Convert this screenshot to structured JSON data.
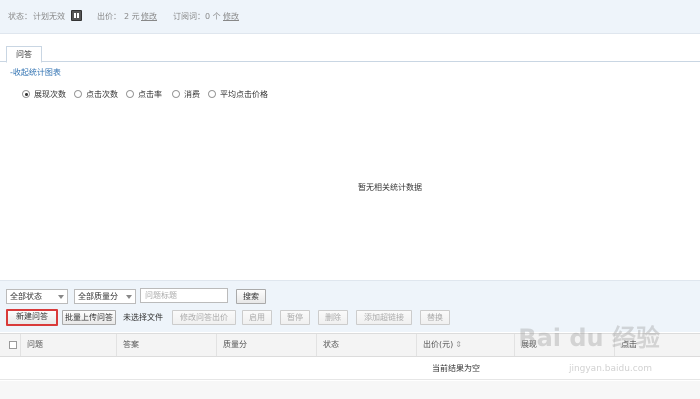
{
  "status_bar": {
    "status_label": "状态：",
    "status_value": "计划无效",
    "bid_label": "出价：",
    "bid_value": "2 元",
    "bid_edit": "修改",
    "subs_label": "订阅词：",
    "subs_value": "0 个",
    "subs_edit": "修改"
  },
  "tabs": [
    {
      "label": "问答"
    }
  ],
  "collapse_link": "-收起统计图表",
  "metrics": [
    {
      "label": "展现次数",
      "selected": true
    },
    {
      "label": "点击次数",
      "selected": false
    },
    {
      "label": "点击率",
      "selected": false
    },
    {
      "label": "消费",
      "selected": false
    },
    {
      "label": "平均点击价格",
      "selected": false
    }
  ],
  "chart_empty_text": "暂无相关统计数据",
  "filters": {
    "status_select": "全部状态",
    "quality_select": "全部质量分",
    "title_placeholder": "问题标题",
    "search_button": "搜索"
  },
  "actions": {
    "new_qa": "新建问答",
    "batch_upload": "批量上传问答",
    "no_file": "未选择文件",
    "edit_bid": "修改问答出价",
    "enable": "启用",
    "pause": "暂停",
    "delete": "删除",
    "add_link": "添加超链接",
    "replace": "替换"
  },
  "table": {
    "columns": [
      "问题",
      "答案",
      "质量分",
      "状态",
      "出价(元)",
      "展现",
      "点击"
    ],
    "empty_text": "当前结果为空"
  },
  "watermark": {
    "logo": "Bai du 经验",
    "url": "jingyan.baidu.com"
  }
}
